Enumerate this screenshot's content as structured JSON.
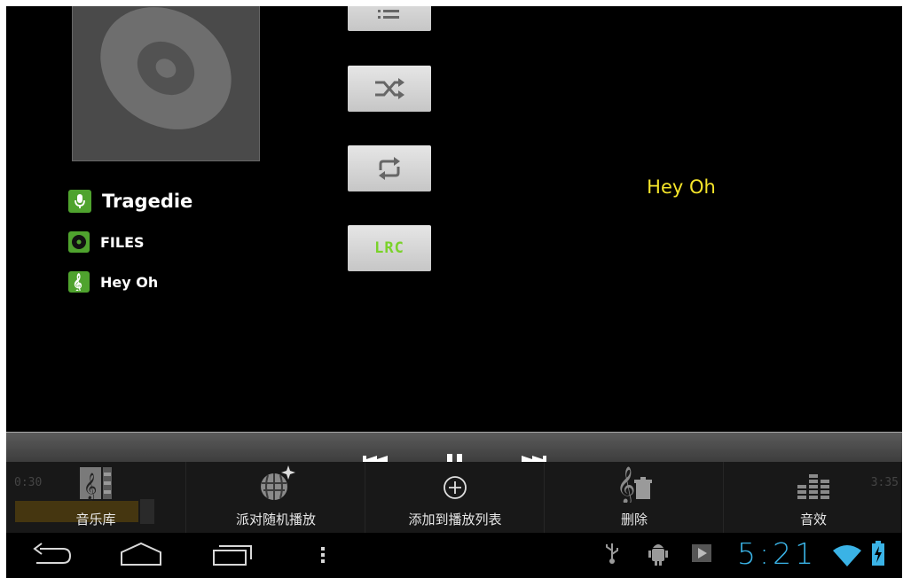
{
  "track": {
    "artist": "Tragedie",
    "album": "FILES",
    "title": "Hey Oh"
  },
  "controls": {
    "lrc_label": "LRC"
  },
  "lyrics": {
    "current_line": "Hey Oh"
  },
  "progress": {
    "elapsed": "0:30",
    "total": "3:35",
    "fraction": 0.14
  },
  "menu": {
    "items": [
      {
        "label": "音乐库",
        "icon": "music-library-icon"
      },
      {
        "label": "派对随机播放",
        "icon": "party-shuffle-icon"
      },
      {
        "label": "添加到播放列表",
        "icon": "add-to-playlist-icon"
      },
      {
        "label": "删除",
        "icon": "delete-icon"
      },
      {
        "label": "音效",
        "icon": "sound-effects-icon"
      }
    ]
  },
  "status": {
    "clock": "5:21"
  },
  "colors": {
    "accent": "#3ab3e6",
    "lyric": "#f5e52a",
    "info_icon_bg": "#4fa32e",
    "lrc_green": "#7ad22a"
  }
}
